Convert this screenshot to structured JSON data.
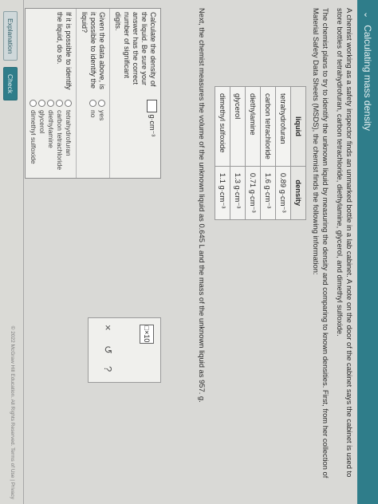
{
  "header": {
    "title": "Calculating mass density",
    "chevron": "⌄"
  },
  "intro": {
    "p1": "A chemist working as a safety inspector finds an unmarked bottle in a lab cabinet. A note on the door of the cabinet says the cabinet is used to store bottles of tetrahydrofuran, carbon tetrachloride, diethylamine, glycerol, and dimethyl sulfoxide.",
    "p2": "The chemist plans to try to identify the unknown liquid by measuring the density and comparing to known densities. First, from her collection of Material Safety Data Sheets (MSDS), the chemist finds the following information:"
  },
  "table": {
    "headers": [
      "liquid",
      "density"
    ],
    "rows": [
      [
        "tetrahydrofuran",
        "0.89 g·cm⁻³"
      ],
      [
        "carbon tetrachloride",
        "1.6 g·cm⁻³"
      ],
      [
        "diethylamine",
        "0.71 g·cm⁻³"
      ],
      [
        "glycerol",
        "1.3 g·cm⁻³"
      ],
      [
        "dimethyl sulfoxide",
        "1.1 g·cm⁻³"
      ]
    ]
  },
  "next_text": "Next, the chemist measures the volume of the unknown liquid as 0.645 L and the mass of the unknown liquid as 957. g.",
  "questions": {
    "q1_text": "Calculate the density of the liquid. Be sure your answer has the correct number of significant digits.",
    "q1_unit": "g·cm⁻³",
    "q2_text": "Given the data above, is it possible to identify the liquid?",
    "q2_options": [
      "yes",
      "no"
    ],
    "q3_text": "If it is possible to identify the liquid, do so.",
    "q3_options": [
      "tetrahydrofuran",
      "carbon tetrachloride",
      "diethylamine",
      "glycerol",
      "dimethyl sulfoxide"
    ]
  },
  "panel": {
    "tool_label": "□×10",
    "x_icon": "×",
    "undo_icon": "↺",
    "help_icon": "?"
  },
  "footer": {
    "explanation_label": "Explanation",
    "check_label": "Check",
    "copyright": "© 2022 McGraw Hill Education. All Rights Reserved. Terms of Use | Privacy"
  }
}
